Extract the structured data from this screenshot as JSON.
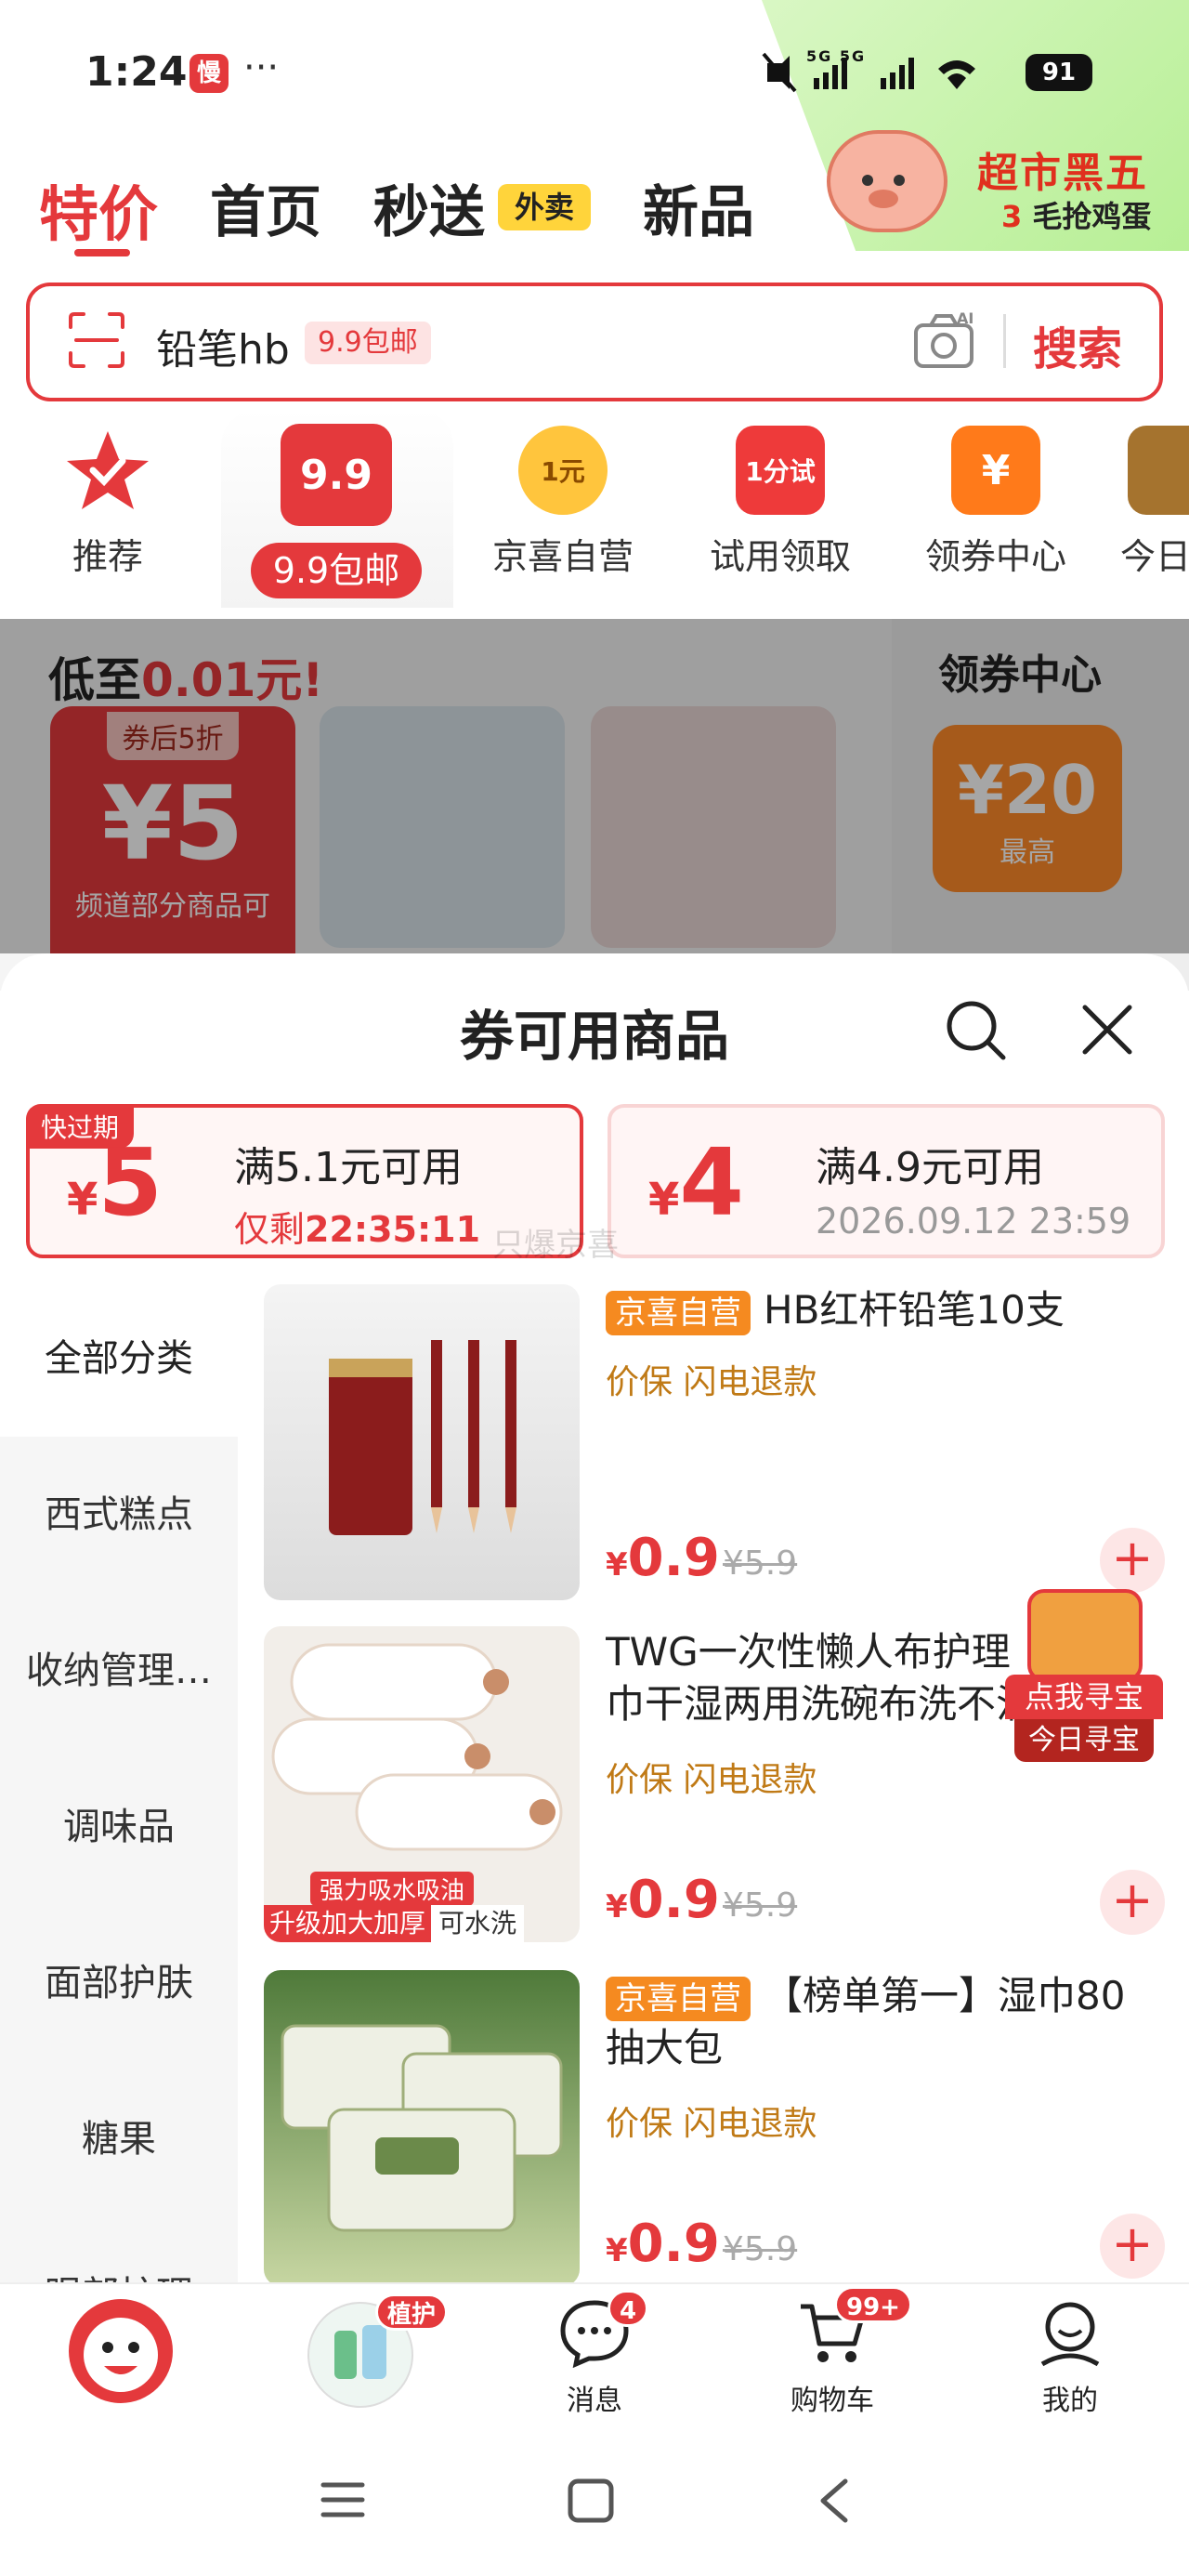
{
  "status": {
    "time": "1:24",
    "app_badge": "慢",
    "dots": "···",
    "signal_text": "5G 5G",
    "battery": "91"
  },
  "promo": {
    "title": "超市黑五",
    "sub_num": "3",
    "sub_text": "毛抢鸡蛋"
  },
  "tabs": [
    {
      "label": "特价"
    },
    {
      "label": "首页"
    },
    {
      "label": "秒送",
      "badge": "外卖"
    },
    {
      "label": "新品"
    }
  ],
  "search": {
    "query": "铅笔hb",
    "tag": "9.9包邮",
    "button": "搜索",
    "ai_label": "AI"
  },
  "categories": [
    {
      "label": "推荐",
      "icon": "star-check-icon"
    },
    {
      "label": "9.9包邮",
      "icon_text": "9.9"
    },
    {
      "label": "京喜自营",
      "icon_text": "1元"
    },
    {
      "label": "试用领取",
      "icon_text": "1分试"
    },
    {
      "label": "领券中心",
      "icon_text": "¥"
    },
    {
      "label": "今日"
    }
  ],
  "banner": {
    "title_prefix": "低至",
    "title_highlight": "0.01元!",
    "coupon_top": "券后5折",
    "coupon_amount": "¥5",
    "coupon_note": "频道部分商品可",
    "voucher_center": "领券中心",
    "voucher_amount": "¥20",
    "voucher_note": "最高"
  },
  "sheet": {
    "title": "券可用商品",
    "watermark": "只爆京喜",
    "coupons": [
      {
        "expire_tag": "快过期",
        "amount": "5",
        "currency": "¥",
        "condition": "满5.1元可用",
        "sub_prefix": "仅剩",
        "sub_value": "22:35:11"
      },
      {
        "amount": "4",
        "currency": "¥",
        "condition": "满4.9元可用",
        "sub_value": "2026.09.12 23:59"
      }
    ],
    "sidebar": [
      "全部分类",
      "西式糕点",
      "收纳管理…",
      "调味品",
      "面部护肤",
      "糖果",
      "眼部护理"
    ],
    "products": [
      {
        "tag": "京喜自营",
        "title": "HB红杆铅笔10支",
        "services": "价保  闪电退款",
        "price": "0.9",
        "original": "¥5.9"
      },
      {
        "tag": "",
        "title": "TWG一次性懒人布护理巾干湿两用洗碗布洗不沾油",
        "services": "价保  闪电退款",
        "price": "0.9",
        "original": "¥5.9",
        "img_caption1": "强力吸水吸油",
        "img_caption2": "升级加大加厚",
        "img_caption3": "可水洗"
      },
      {
        "tag": "京喜自营",
        "title": "【榜单第一】湿巾80抽大包",
        "services": "价保  闪电退款",
        "price": "0.9",
        "original": "¥5.9"
      }
    ],
    "treasure": {
      "line1": "点我寻宝",
      "line2": "今日寻宝"
    }
  },
  "bottom_nav": [
    {
      "label": "",
      "icon": "jd-mascot-icon"
    },
    {
      "label": "",
      "badge": "植护",
      "icon": "product-thumb-icon"
    },
    {
      "label": "消息",
      "badge": "4",
      "icon": "message-icon"
    },
    {
      "label": "购物车",
      "badge": "99+",
      "icon": "cart-icon"
    },
    {
      "label": "我的",
      "icon": "user-icon"
    }
  ],
  "colors": {
    "accent": "#e4393c",
    "self_op_tag": "#f58a20",
    "service_text": "#c07a16",
    "promo_green": "#b7ef95"
  }
}
